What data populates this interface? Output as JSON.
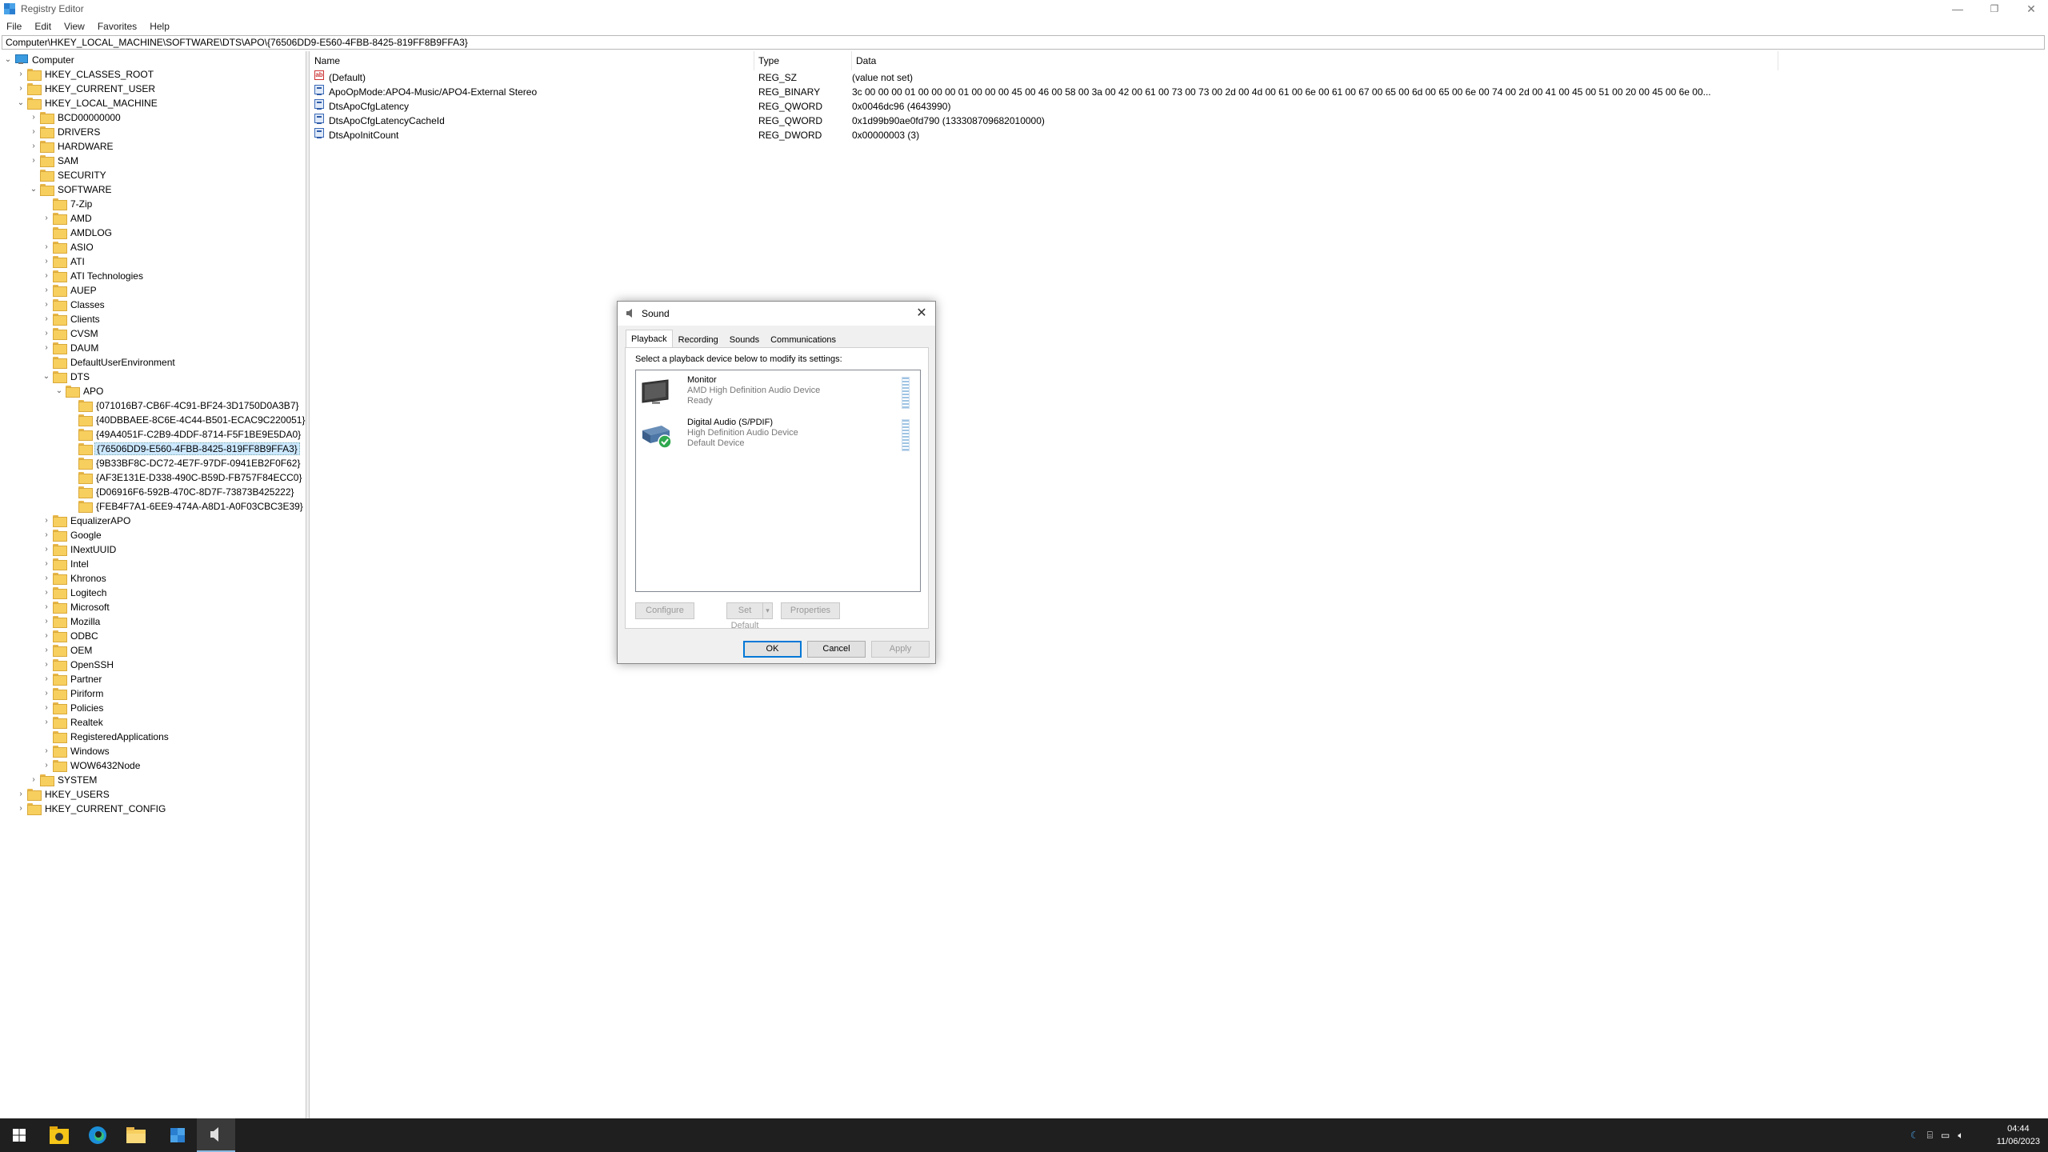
{
  "window": {
    "title": "Registry Editor",
    "controls": {
      "minimize": "—",
      "restore": "❐",
      "close": "✕"
    }
  },
  "menu": [
    "File",
    "Edit",
    "View",
    "Favorites",
    "Help"
  ],
  "address": "Computer\\HKEY_LOCAL_MACHINE\\SOFTWARE\\DTS\\APO\\{76506DD9-E560-4FBB-8425-819FF8B9FFA3}",
  "tree": [
    {
      "label": "Computer",
      "level": 0,
      "state": "open",
      "icon": "computer-icon"
    },
    {
      "label": "HKEY_CLASSES_ROOT",
      "level": 1,
      "state": "closed"
    },
    {
      "label": "HKEY_CURRENT_USER",
      "level": 1,
      "state": "closed"
    },
    {
      "label": "HKEY_LOCAL_MACHINE",
      "level": 1,
      "state": "open"
    },
    {
      "label": "BCD00000000",
      "level": 2,
      "state": "closed"
    },
    {
      "label": "DRIVERS",
      "level": 2,
      "state": "closed"
    },
    {
      "label": "HARDWARE",
      "level": 2,
      "state": "closed"
    },
    {
      "label": "SAM",
      "level": 2,
      "state": "closed"
    },
    {
      "label": "SECURITY",
      "level": 2,
      "state": "none"
    },
    {
      "label": "SOFTWARE",
      "level": 2,
      "state": "open"
    },
    {
      "label": "7-Zip",
      "level": 3,
      "state": "none"
    },
    {
      "label": "AMD",
      "level": 3,
      "state": "closed"
    },
    {
      "label": "AMDLOG",
      "level": 3,
      "state": "none"
    },
    {
      "label": "ASIO",
      "level": 3,
      "state": "closed"
    },
    {
      "label": "ATI",
      "level": 3,
      "state": "closed"
    },
    {
      "label": "ATI Technologies",
      "level": 3,
      "state": "closed"
    },
    {
      "label": "AUEP",
      "level": 3,
      "state": "closed"
    },
    {
      "label": "Classes",
      "level": 3,
      "state": "closed"
    },
    {
      "label": "Clients",
      "level": 3,
      "state": "closed"
    },
    {
      "label": "CVSM",
      "level": 3,
      "state": "closed"
    },
    {
      "label": "DAUM",
      "level": 3,
      "state": "closed"
    },
    {
      "label": "DefaultUserEnvironment",
      "level": 3,
      "state": "none"
    },
    {
      "label": "DTS",
      "level": 3,
      "state": "open"
    },
    {
      "label": "APO",
      "level": 4,
      "state": "open"
    },
    {
      "label": "{071016B7-CB6F-4C91-BF24-3D1750D0A3B7}",
      "level": 5,
      "state": "none"
    },
    {
      "label": "{40DBBAEE-8C6E-4C44-B501-ECAC9C220051}",
      "level": 5,
      "state": "none"
    },
    {
      "label": "{49A4051F-C2B9-4DDF-8714-F5F1BE9E5DA0}",
      "level": 5,
      "state": "none"
    },
    {
      "label": "{76506DD9-E560-4FBB-8425-819FF8B9FFA3}",
      "level": 5,
      "state": "none",
      "selected": true
    },
    {
      "label": "{9B33BF8C-DC72-4E7F-97DF-0941EB2F0F62}",
      "level": 5,
      "state": "none"
    },
    {
      "label": "{AF3E131E-D338-490C-B59D-FB757F84ECC0}",
      "level": 5,
      "state": "none"
    },
    {
      "label": "{D06916F6-592B-470C-8D7F-73873B425222}",
      "level": 5,
      "state": "none"
    },
    {
      "label": "{FEB4F7A1-6EE9-474A-A8D1-A0F03CBC3E39}",
      "level": 5,
      "state": "none"
    },
    {
      "label": "EqualizerAPO",
      "level": 3,
      "state": "closed"
    },
    {
      "label": "Google",
      "level": 3,
      "state": "closed"
    },
    {
      "label": "INextUUID",
      "level": 3,
      "state": "closed"
    },
    {
      "label": "Intel",
      "level": 3,
      "state": "closed"
    },
    {
      "label": "Khronos",
      "level": 3,
      "state": "closed"
    },
    {
      "label": "Logitech",
      "level": 3,
      "state": "closed"
    },
    {
      "label": "Microsoft",
      "level": 3,
      "state": "closed"
    },
    {
      "label": "Mozilla",
      "level": 3,
      "state": "closed"
    },
    {
      "label": "ODBC",
      "level": 3,
      "state": "closed"
    },
    {
      "label": "OEM",
      "level": 3,
      "state": "closed"
    },
    {
      "label": "OpenSSH",
      "level": 3,
      "state": "closed"
    },
    {
      "label": "Partner",
      "level": 3,
      "state": "closed"
    },
    {
      "label": "Piriform",
      "level": 3,
      "state": "closed"
    },
    {
      "label": "Policies",
      "level": 3,
      "state": "closed"
    },
    {
      "label": "Realtek",
      "level": 3,
      "state": "closed"
    },
    {
      "label": "RegisteredApplications",
      "level": 3,
      "state": "none"
    },
    {
      "label": "Windows",
      "level": 3,
      "state": "closed"
    },
    {
      "label": "WOW6432Node",
      "level": 3,
      "state": "closed"
    },
    {
      "label": "SYSTEM",
      "level": 2,
      "state": "closed"
    },
    {
      "label": "HKEY_USERS",
      "level": 1,
      "state": "closed"
    },
    {
      "label": "HKEY_CURRENT_CONFIG",
      "level": 1,
      "state": "closed"
    }
  ],
  "list": {
    "columns": [
      "Name",
      "Type",
      "Data"
    ],
    "rows": [
      {
        "name": "(Default)",
        "type": "REG_SZ",
        "data": "(value not set)",
        "icon": "string-value-icon",
        "kind": "sz",
        "glyph": "ab"
      },
      {
        "name": "ApoOpMode:APO4-Music/APO4-External Stereo",
        "type": "REG_BINARY",
        "data": "3c 00 00 00 01 00 00 00 01 00 00 00 45 00 46 00 58 00 3a 00 42 00 61 00 73 00 73 00 2d 00 4d 00 61 00 6e 00 61 00 67 00 65 00 6d 00 65 00 6e 00 74 00 2d 00 41 00 45 00 51 00 20 00 45 00 6e 00...",
        "icon": "binary-value-icon",
        "kind": "bin"
      },
      {
        "name": "DtsApoCfgLatency",
        "type": "REG_QWORD",
        "data": "0x0046dc96 (4643990)",
        "icon": "binary-value-icon",
        "kind": "bin"
      },
      {
        "name": "DtsApoCfgLatencyCacheId",
        "type": "REG_QWORD",
        "data": "0x1d99b90ae0fd790 (133308709682010000)",
        "icon": "binary-value-icon",
        "kind": "bin"
      },
      {
        "name": "DtsApoInitCount",
        "type": "REG_DWORD",
        "data": "0x00000003 (3)",
        "icon": "binary-value-icon",
        "kind": "bin"
      }
    ]
  },
  "sound_dialog": {
    "title": "Sound",
    "close": "✕",
    "tabs": [
      "Playback",
      "Recording",
      "Sounds",
      "Communications"
    ],
    "active_tab": "Playback",
    "instructions": "Select a playback device below to modify its settings:",
    "devices": [
      {
        "name": "Monitor",
        "desc": "AMD High Definition Audio Device",
        "state": "Ready",
        "default": false
      },
      {
        "name": "Digital Audio (S/PDIF)",
        "desc": "High Definition Audio Device",
        "state": "Default Device",
        "default": true
      }
    ],
    "buttons": {
      "configure": "Configure",
      "set_default": "Set Default",
      "set_default_arrow": "▾",
      "properties": "Properties",
      "ok": "OK",
      "cancel": "Cancel",
      "apply": "Apply"
    }
  },
  "taskbar": {
    "apps": [
      "start-icon",
      "file-explorer-icon",
      "edge-icon",
      "folder-icon",
      "regedit-icon",
      "sound-icon"
    ],
    "clock_time": "04:44",
    "clock_date": "11/06/2023"
  }
}
